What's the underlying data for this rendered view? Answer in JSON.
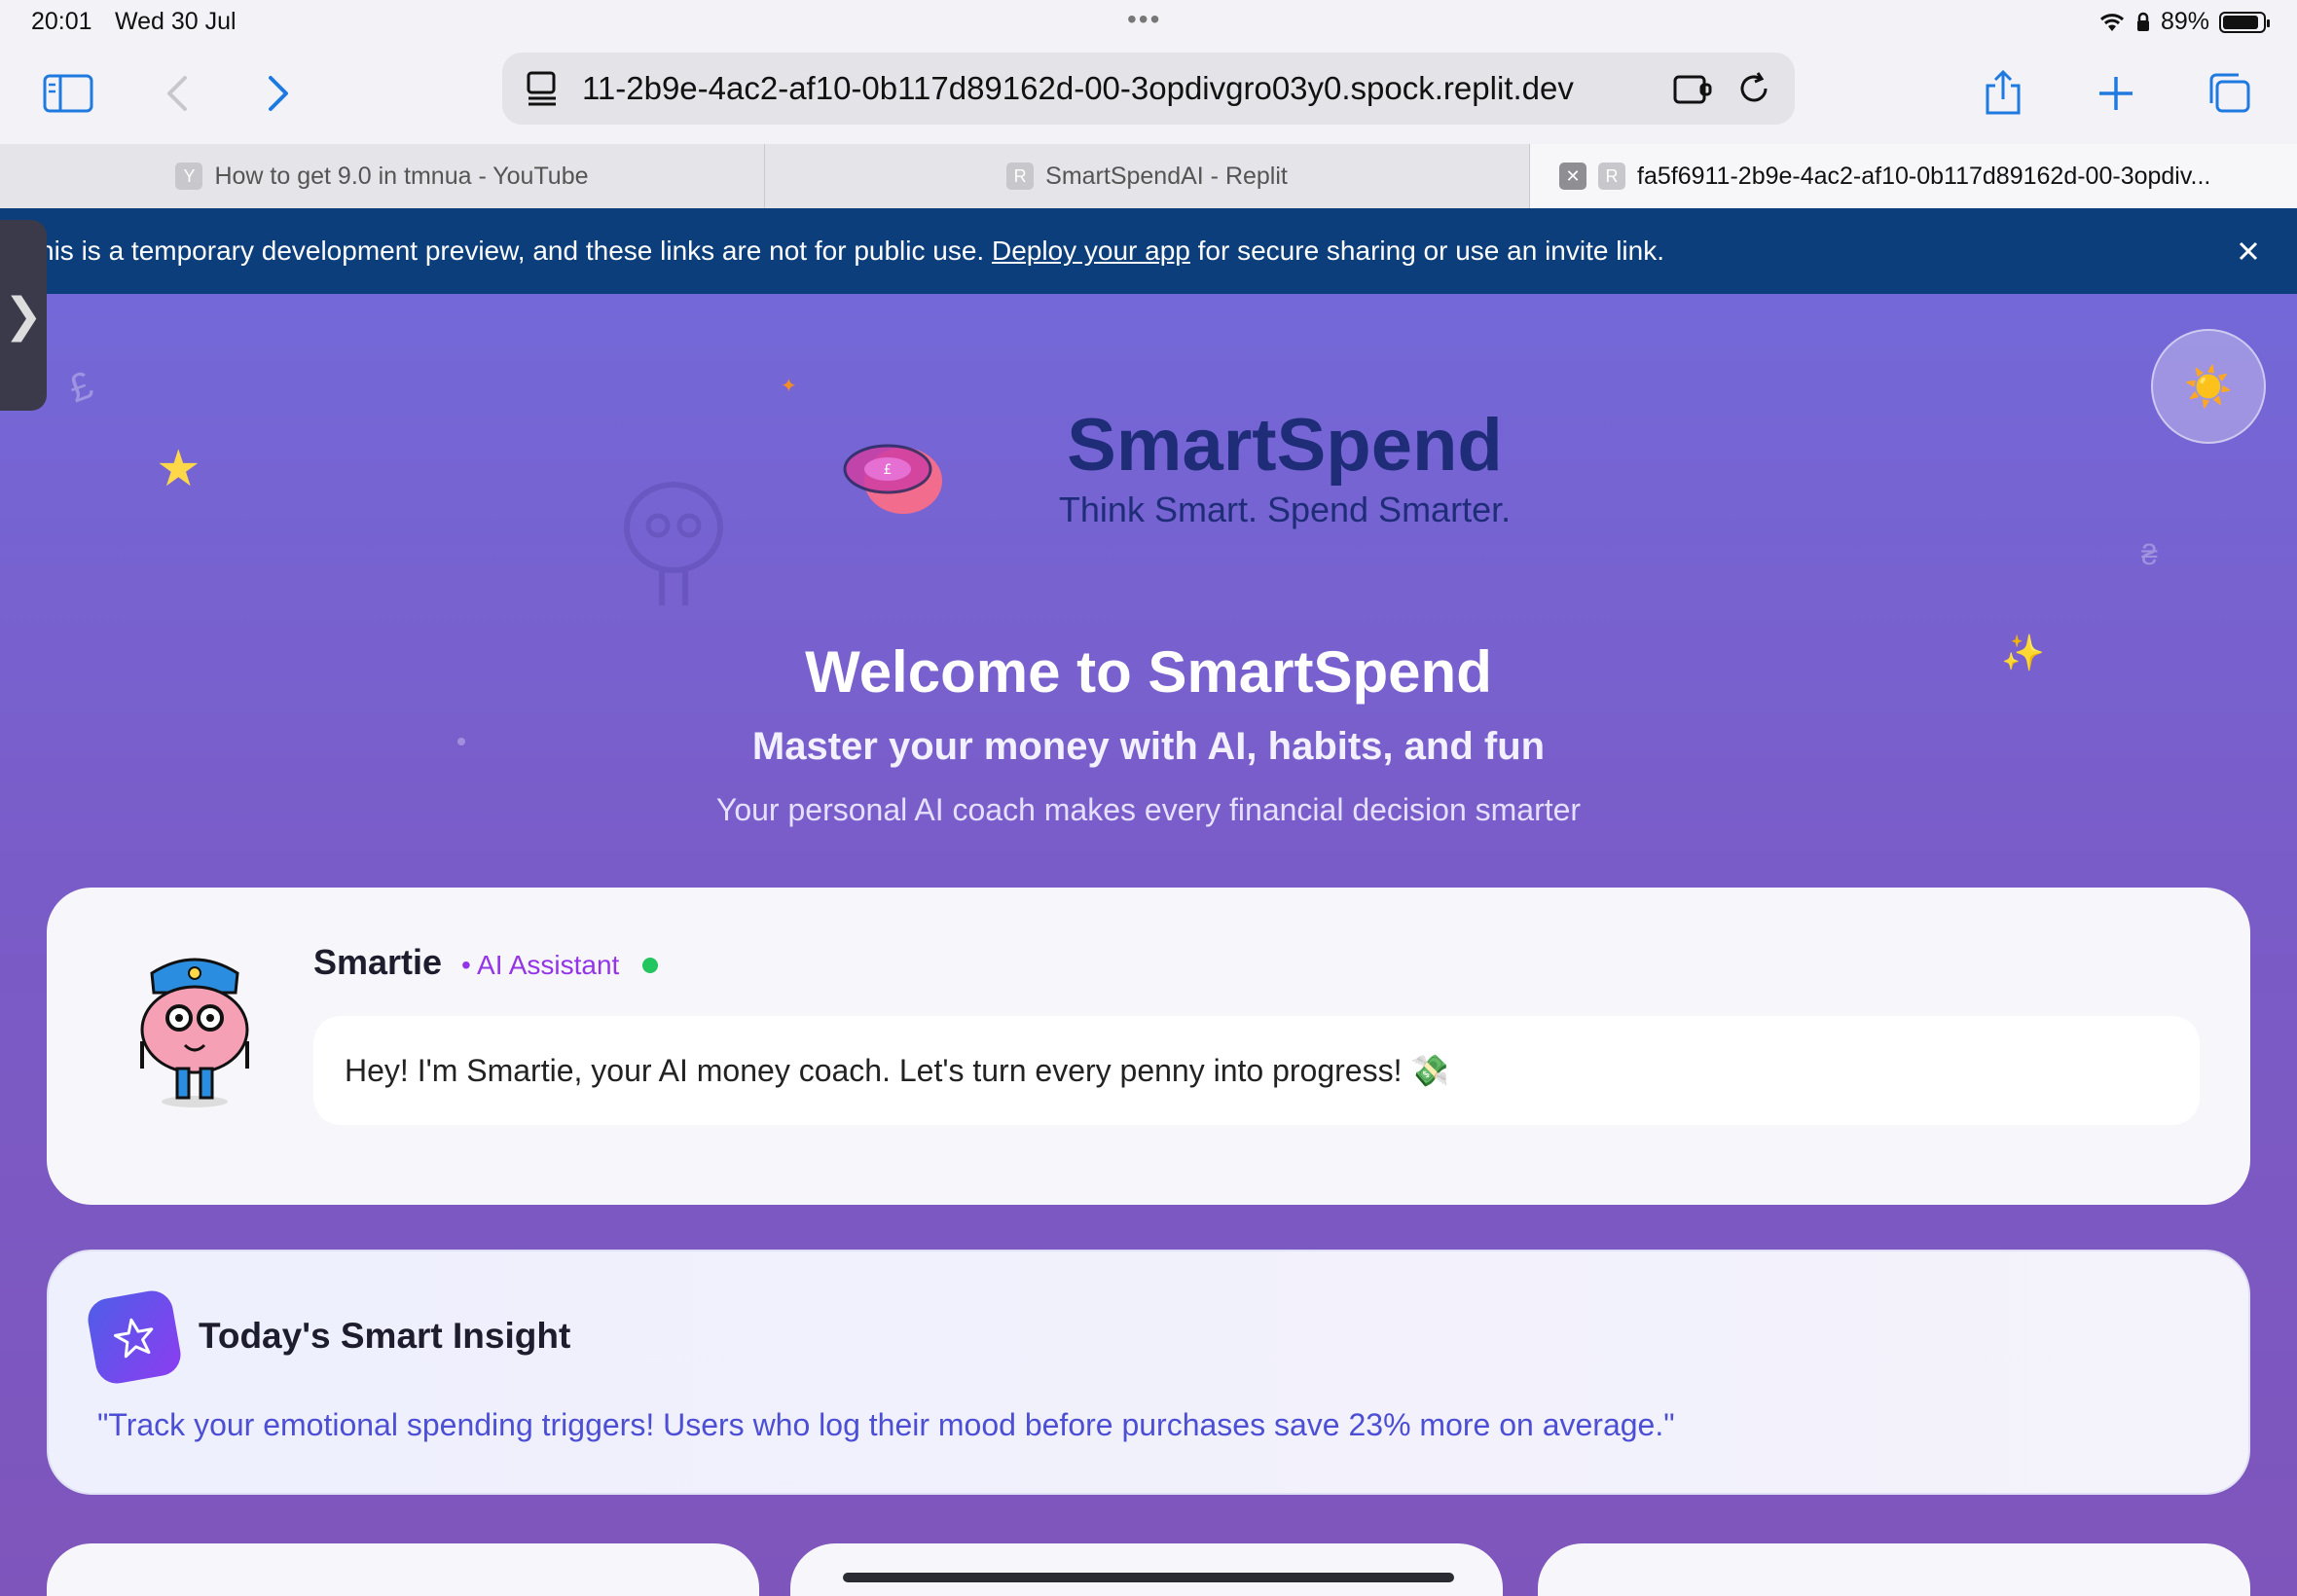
{
  "status_bar": {
    "time": "20:01",
    "date": "Wed 30 Jul",
    "battery": "89%",
    "battery_level": 0.89
  },
  "browser": {
    "url": "11-2b9e-4ac2-af10-0b117d89162d-00-3opdivgro03y0.spock.replit.dev",
    "tabs": [
      {
        "favicon": "Y",
        "label": "How to get 9.0 in tmnua - YouTube"
      },
      {
        "favicon": "R",
        "label": "SmartSpendAI - Replit"
      },
      {
        "favicon": "R",
        "label": "fa5f6911-2b9e-4ac2-af10-0b117d89162d-00-3opdiv..."
      }
    ]
  },
  "banner": {
    "text_before": "his is a temporary development preview, and these links are not for public use.",
    "link": "Deploy your app",
    "text_after": "for secure sharing or use an invite link."
  },
  "brand": {
    "title": "SmartSpend",
    "tagline": "Think Smart. Spend Smarter."
  },
  "welcome": {
    "title": "Welcome to SmartSpend",
    "subtitle": "Master your money with AI, habits, and fun",
    "description": "Your personal AI coach makes every financial decision smarter"
  },
  "assistant": {
    "name": "Smartie",
    "role": "• AI Assistant",
    "message": "Hey! I'm Smartie, your AI money coach. Let's turn every penny into progress! 💸"
  },
  "insight": {
    "title": "Today's Smart Insight",
    "text": "\"Track your emotional spending triggers! Users who log their mood before purchases save 23% more on average.\""
  },
  "colors": {
    "accent": "#7468d8",
    "brand_navy": "#1f2d78",
    "banner": "#0b3e7a",
    "insight_text": "#4c4fd4",
    "online": "#22c55e"
  }
}
